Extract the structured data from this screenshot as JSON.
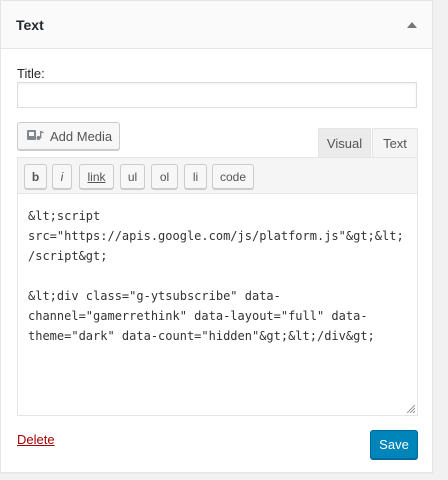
{
  "widget": {
    "title": "Text"
  },
  "form": {
    "title_label": "Title:",
    "title_value": "",
    "add_media_label": "Add Media",
    "tabs": [
      {
        "label": "Visual"
      },
      {
        "label": "Text"
      }
    ],
    "quicktags": [
      {
        "label": "b"
      },
      {
        "label": "i"
      },
      {
        "label": "link"
      },
      {
        "label": "ul"
      },
      {
        "label": "ol"
      },
      {
        "label": "li"
      },
      {
        "label": "code"
      }
    ],
    "content": "&lt;script\nsrc=\"https://apis.google.com/js/platform.js\"&gt;&lt;\n/script&gt;\n\n&lt;div class=\"g-ytsubscribe\" data-\nchannel=\"gamerrethink\" data-layout=\"full\" data-\ntheme=\"dark\" data-count=\"hidden\"&gt;&lt;/div&gt;"
  },
  "footer": {
    "delete_label": "Delete",
    "save_label": "Save"
  },
  "colors": {
    "primary": "#0085ba",
    "delete": "#a00000"
  }
}
